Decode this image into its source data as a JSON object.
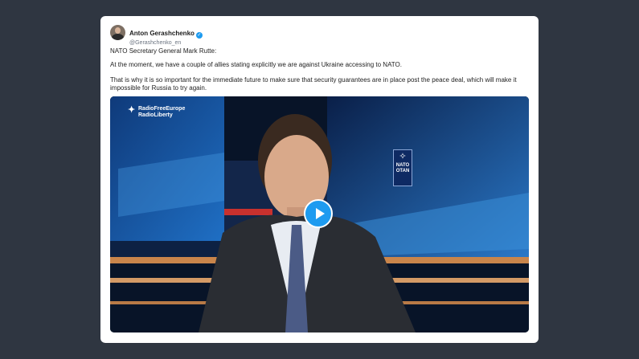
{
  "tweet": {
    "author_name": "Anton Gerashchenko",
    "handle": "@Gerashchenko_en",
    "verified_icon": "verified-badge-icon",
    "paragraphs": [
      "NATO Secretary General Mark Rutte:",
      "At the moment, we have a couple of allies stating explicitly we are against Ukraine accessing to NATO.",
      "That is why it is so important for the immediate future to make sure that security guarantees are in place post the peace deal, which will make it impossible for Russia to try again."
    ]
  },
  "video": {
    "broadcaster_line1": "RadioFreeEurope",
    "broadcaster_line2": "RadioLiberty",
    "nato_en": "NATO",
    "nato_fr": "OTAN",
    "play_icon": "play-icon"
  },
  "colors": {
    "page_bg": "#2f3641",
    "accent": "#1d9bf0"
  }
}
